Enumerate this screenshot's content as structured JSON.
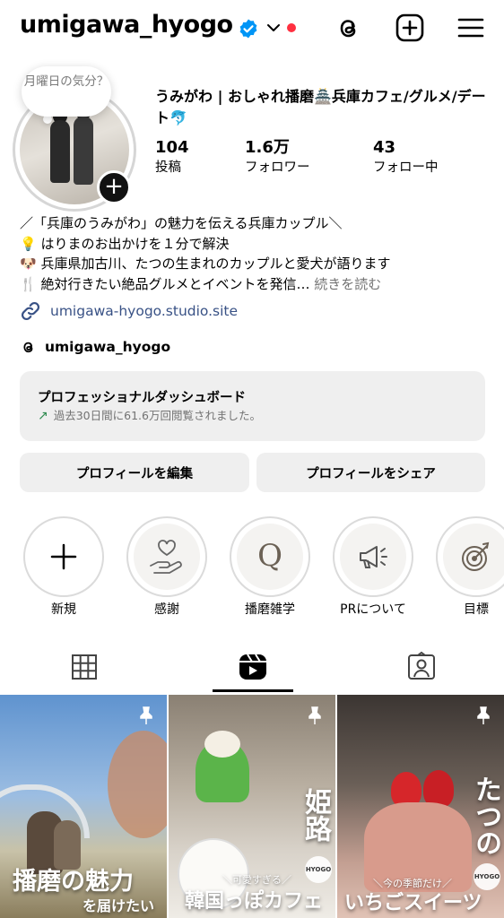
{
  "header": {
    "username": "umigawa_hyogo",
    "icons": [
      "verified-badge-icon",
      "chevron-down-icon",
      "notification-dot",
      "threads-icon",
      "create-plus-icon",
      "menu-icon"
    ]
  },
  "profile": {
    "note": "月曜日の気分？",
    "display_name": "うみがわ | おしゃれ播磨🏯兵庫カフェ/グルメ/デート🐬",
    "stats": [
      {
        "value": "104",
        "label": "投稿"
      },
      {
        "value": "1.6万",
        "label": "フォロワー"
      },
      {
        "value": "43",
        "label": "フォロー中"
      }
    ],
    "bio": [
      "／「兵庫のうみがわ」の魅力を伝える兵庫カップル＼",
      "💡 はりまのお出かけを１分で解決",
      "🐶 兵庫県加古川、たつの生まれのカップルと愛犬が語ります",
      "🍴 絶対行きたい絶品グルメとイベントを発信…"
    ],
    "more": "続きを読む",
    "link": "umigawa-hyogo.studio.site",
    "threads_handle": "umigawa_hyogo"
  },
  "dashboard": {
    "title": "プロフェッショナルダッシュボード",
    "subtitle": "過去30日間に61.6万回閲覧されました。"
  },
  "buttons": {
    "edit": "プロフィールを編集",
    "share": "プロフィールをシェア"
  },
  "highlights": [
    {
      "label": "新規",
      "icon": "plus-icon"
    },
    {
      "label": "感謝",
      "icon": "heart-hand-icon"
    },
    {
      "label": "播磨雑学",
      "icon": "q-letter-icon"
    },
    {
      "label": "PRについて",
      "icon": "megaphone-icon"
    },
    {
      "label": "目標",
      "icon": "target-icon"
    }
  ],
  "tabs": [
    "grid-icon",
    "reels-icon",
    "tagged-icon"
  ],
  "posts": [
    {
      "big": "播磨の魅力",
      "small": "を届けたい",
      "pinned": true
    },
    {
      "big": "姫路",
      "sub": "＼可愛すぎる／",
      "big2": "韓国っぽカフェ",
      "badge": "HYOGO",
      "pinned": true
    },
    {
      "big": "たつの",
      "sub": "＼今の季節だけ／",
      "big2": "いちごスイーツ",
      "badge": "HYOGO",
      "pinned": true
    }
  ],
  "colors": {
    "link": "#385185",
    "verified": "#0095f6",
    "dot": "#ff3040",
    "button_bg": "#efefef",
    "muted": "#737373"
  }
}
